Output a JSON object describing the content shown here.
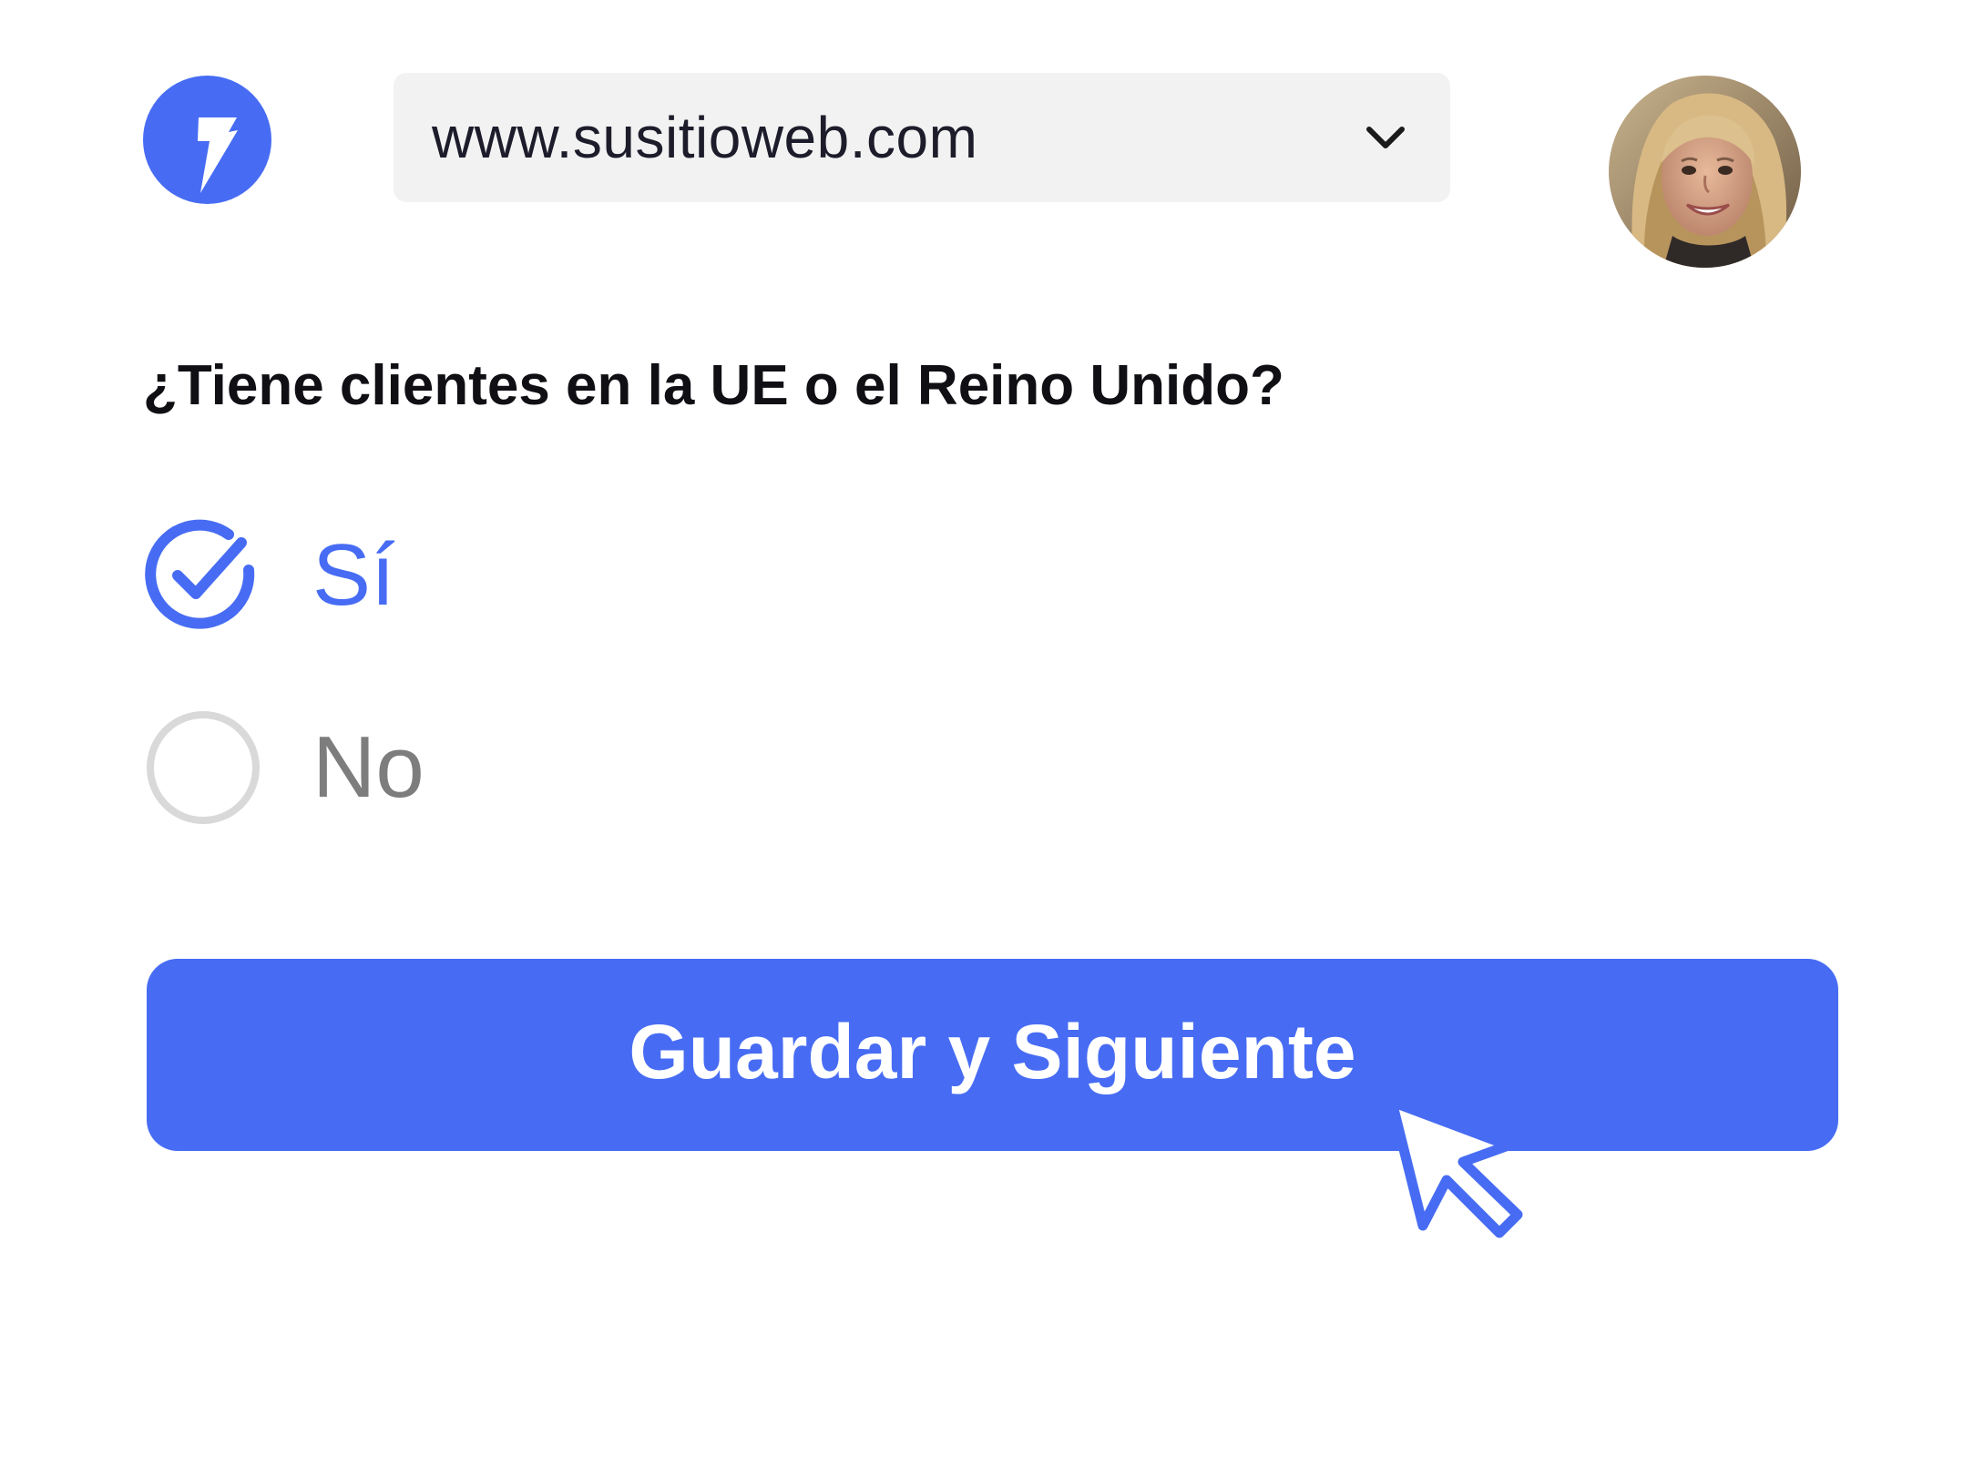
{
  "colors": {
    "accent": "#476cf3",
    "select_bg": "#f2f2f2",
    "muted_text": "#7d7d7d",
    "radio_unchecked": "#d9d9d9"
  },
  "header": {
    "logo_icon": "lightning-bolt-icon",
    "site_selector": {
      "value": "www.susitioweb.com",
      "icon": "chevron-down-icon"
    },
    "avatar": "user-avatar"
  },
  "form": {
    "question": "¿Tiene clientes en la UE o el Reino Unido?",
    "options": [
      {
        "label": "Sí",
        "selected": true,
        "icon": "check-circle-icon"
      },
      {
        "label": "No",
        "selected": false,
        "icon": "empty-radio-circle-icon"
      }
    ],
    "submit_label": "Guardar y Siguiente"
  },
  "pointer_icon": "mouse-pointer-icon"
}
